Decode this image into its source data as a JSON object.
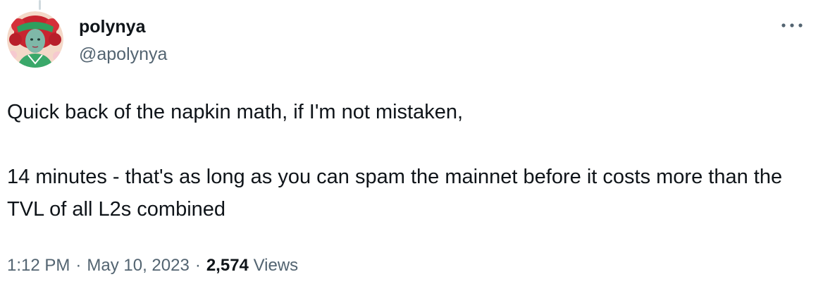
{
  "author": {
    "display_name": "polynya",
    "handle": "@apolynya",
    "avatar_icon": "profile-avatar-illustration"
  },
  "tweet": {
    "paragraphs": [
      "Quick back of the napkin math, if I'm not mistaken,",
      "14 minutes - that's as long as you can spam the mainnet before it costs more than the TVL of all L2s combined"
    ]
  },
  "meta": {
    "time": "1:12 PM",
    "separator": "·",
    "date": "May 10, 2023",
    "views_count": "2,574",
    "views_label": "Views"
  },
  "icons": {
    "more": "more-options-icon"
  },
  "colors": {
    "text_primary": "#0f1419",
    "text_secondary": "#536471",
    "background": "#ffffff",
    "thread_line": "#cfd9de"
  }
}
